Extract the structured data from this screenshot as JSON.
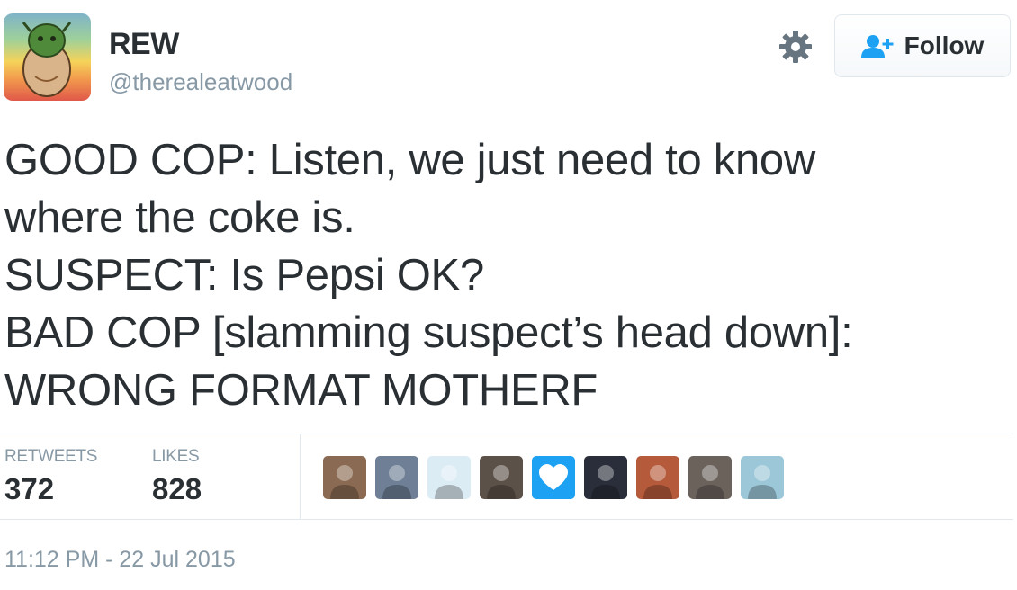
{
  "author": {
    "display_name": "REW",
    "handle": "@therealeatwood",
    "avatar": "avatar-illustration"
  },
  "actions": {
    "settings_icon": "gear-icon",
    "follow_label": "Follow",
    "follow_icon": "add-person-icon",
    "accent_color": "#1da1f2"
  },
  "tweet": {
    "lines": [
      "GOOD COP: Listen, we just need to know",
      "where the coke is.",
      "SUSPECT: Is Pepsi OK?",
      "BAD COP [slamming suspect’s head down]:",
      "WRONG FORMAT MOTHERF"
    ]
  },
  "stats": {
    "retweets_label": "RETWEETS",
    "retweets_count": "372",
    "likes_label": "LIKES",
    "likes_count": "828"
  },
  "likers": [
    {
      "name": "liker-avatar-1",
      "color": "#8a6a52"
    },
    {
      "name": "liker-avatar-2",
      "color": "#6e7f96"
    },
    {
      "name": "liker-avatar-3",
      "color": "#dcecf4"
    },
    {
      "name": "liker-avatar-4",
      "color": "#5c5148"
    },
    {
      "name": "liker-avatar-5",
      "color": "#1da1f2",
      "icon": "heart-icon"
    },
    {
      "name": "liker-avatar-6",
      "color": "#2a2e3a"
    },
    {
      "name": "liker-avatar-7",
      "color": "#b55a3a"
    },
    {
      "name": "liker-avatar-8",
      "color": "#6b625c"
    },
    {
      "name": "liker-avatar-9",
      "color": "#9cc7d8"
    }
  ],
  "timestamp": "11:12 PM - 22 Jul 2015"
}
